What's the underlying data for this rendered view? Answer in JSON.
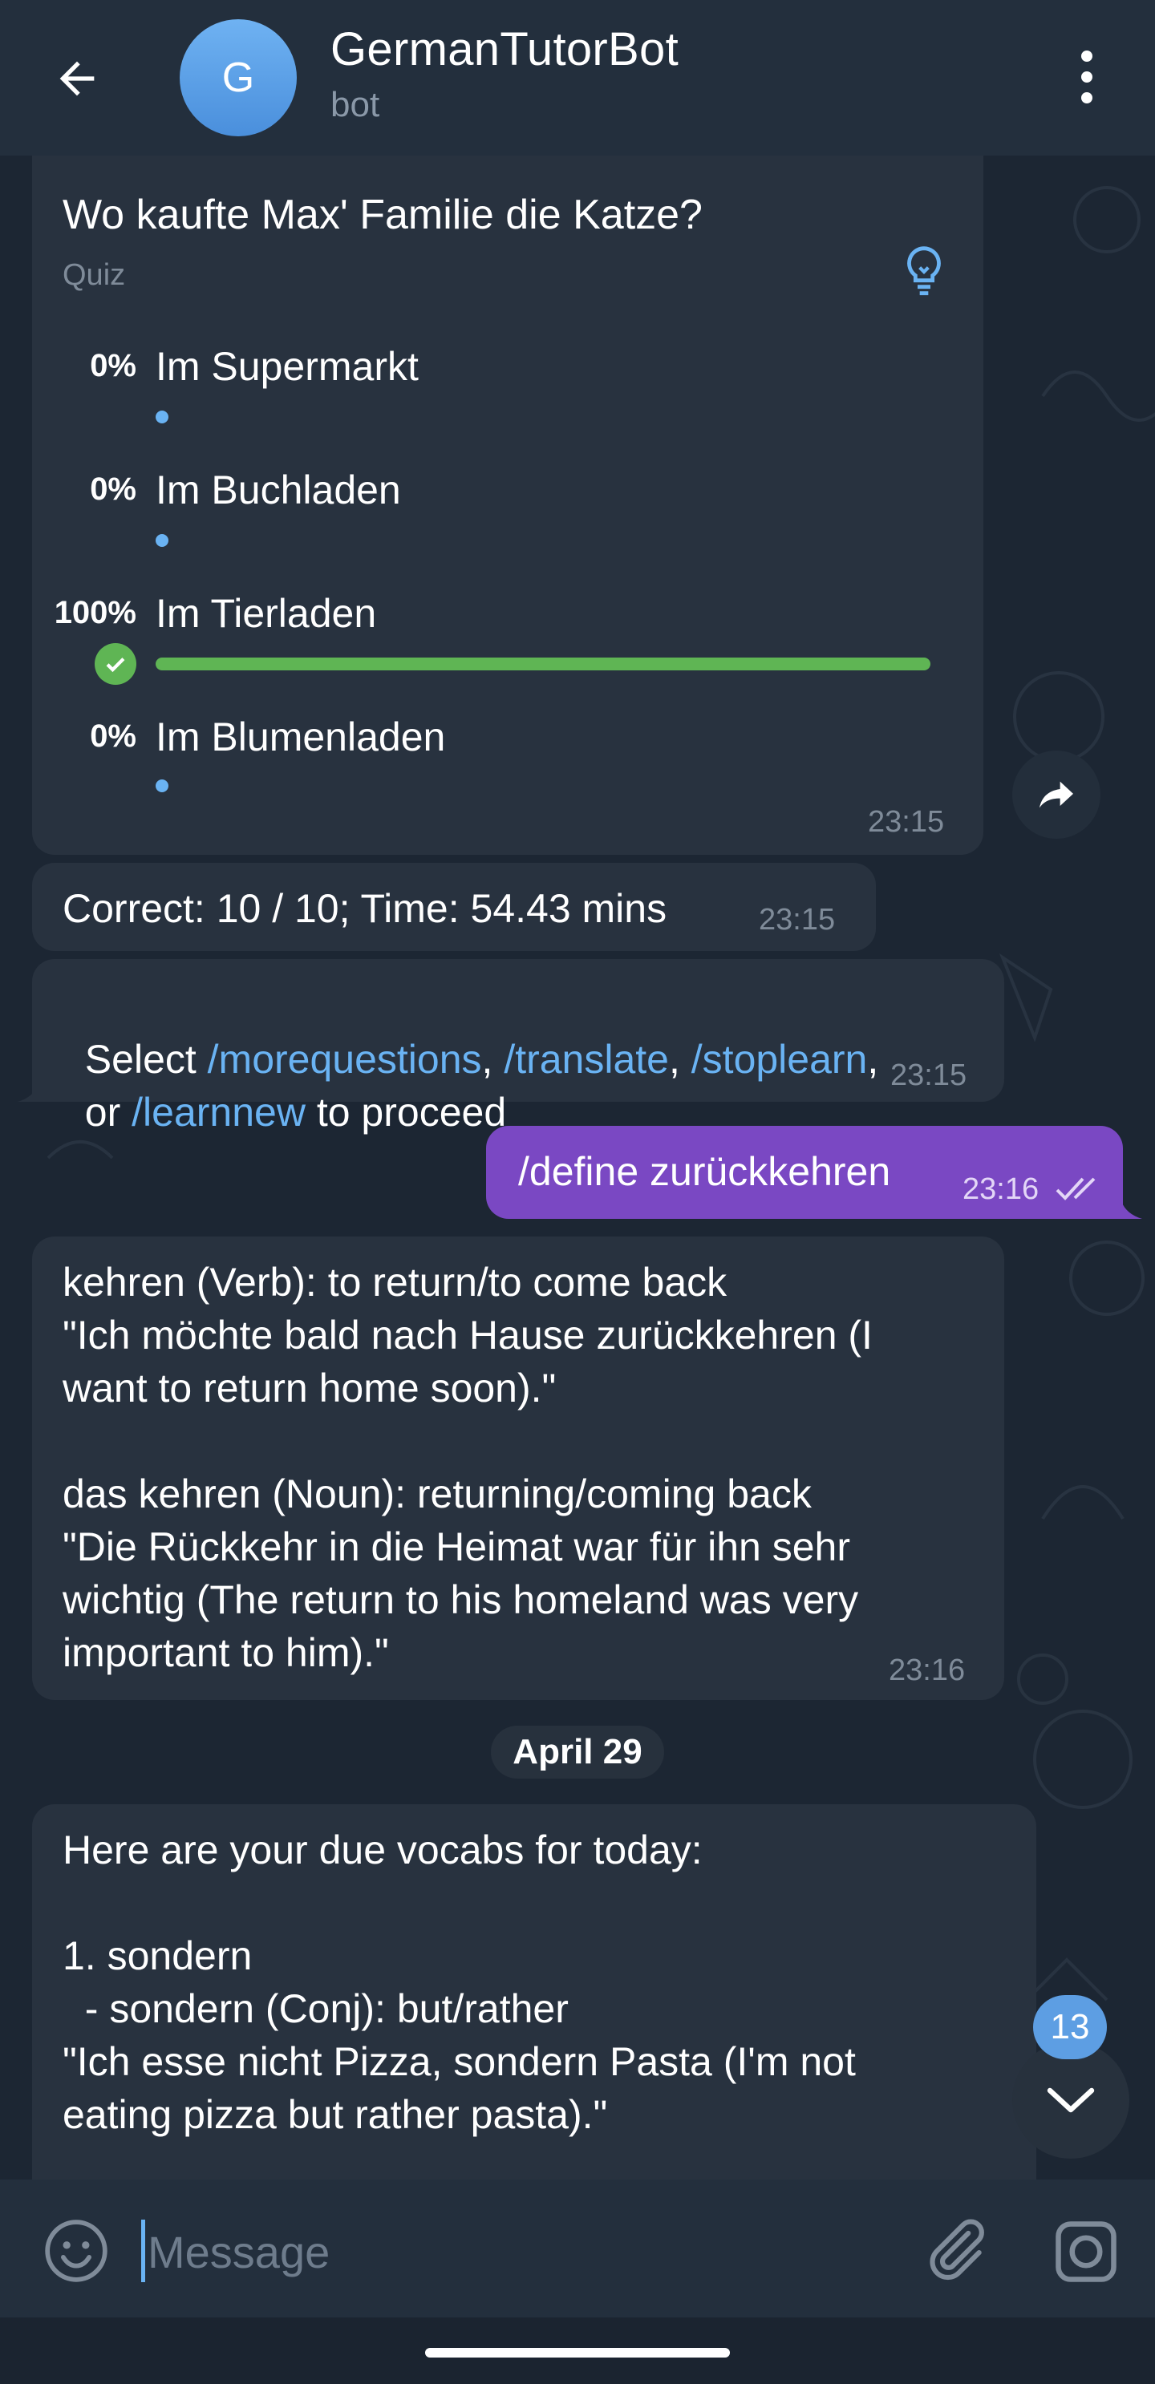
{
  "header": {
    "avatar_letter": "G",
    "title": "GermanTutorBot",
    "subtitle": "bot"
  },
  "quiz": {
    "question": "Wo kaufte Max' Familie die Katze?",
    "type_label": "Quiz",
    "options": [
      {
        "percent": "0%",
        "label": "Im Supermarkt",
        "fraction": 0
      },
      {
        "percent": "0%",
        "label": "Im Buchladen",
        "fraction": 0
      },
      {
        "percent": "100%",
        "label": "Im Tierladen",
        "fraction": 1,
        "correct": true
      },
      {
        "percent": "0%",
        "label": "Im Blumenladen",
        "fraction": 0
      }
    ],
    "time": "23:15"
  },
  "messages": {
    "score": {
      "text": "Correct: 10 / 10; Time: 54.43 mins",
      "time": "23:15"
    },
    "select": {
      "prefix": "Select ",
      "cmd1": "/morequestions",
      "sep1": ", ",
      "cmd2": "/translate",
      "sep2": ", ",
      "cmd3": "/stoplearn",
      "sep3": ",",
      "line2_prefix": "or ",
      "cmd4": "/learnnew",
      "suffix": " to proceed",
      "time": "23:15"
    },
    "outgoing": {
      "text": "/define zurückkehren",
      "time": "23:16"
    },
    "definition": {
      "text": "kehren (Verb): to return/to come back\n\"Ich möchte bald nach Hause zurückkehren (I\nwant to return home soon).\"\n\ndas kehren (Noun): returning/coming back\n\"Die Rückkehr in die Heimat war für ihn sehr\nwichtig (The return to his homeland was very\nimportant to him).\"",
      "time": "23:16"
    },
    "date_separator": "April 29",
    "vocabs": {
      "text": "Here are your due vocabs for today:\n\n1. sondern\n  - sondern (Conj): but/rather\n\"Ich esse nicht Pizza, sondern Pasta (I'm not\neating pizza but rather pasta).\""
    }
  },
  "unread_count": "13",
  "composer": {
    "placeholder": "Message"
  },
  "colors": {
    "accent": "#6ab3f3",
    "outgoing_bubble": "#7a48c3",
    "incoming_bubble": "#28323f",
    "correct_green": "#5fb554",
    "header_bg": "#232f3d"
  },
  "icons": [
    "back-arrow-icon",
    "more-vert-icon",
    "lightbulb-icon",
    "check-icon",
    "share-icon",
    "double-check-icon",
    "chevron-down-icon",
    "emoji-icon",
    "attach-icon",
    "camera-icon"
  ]
}
